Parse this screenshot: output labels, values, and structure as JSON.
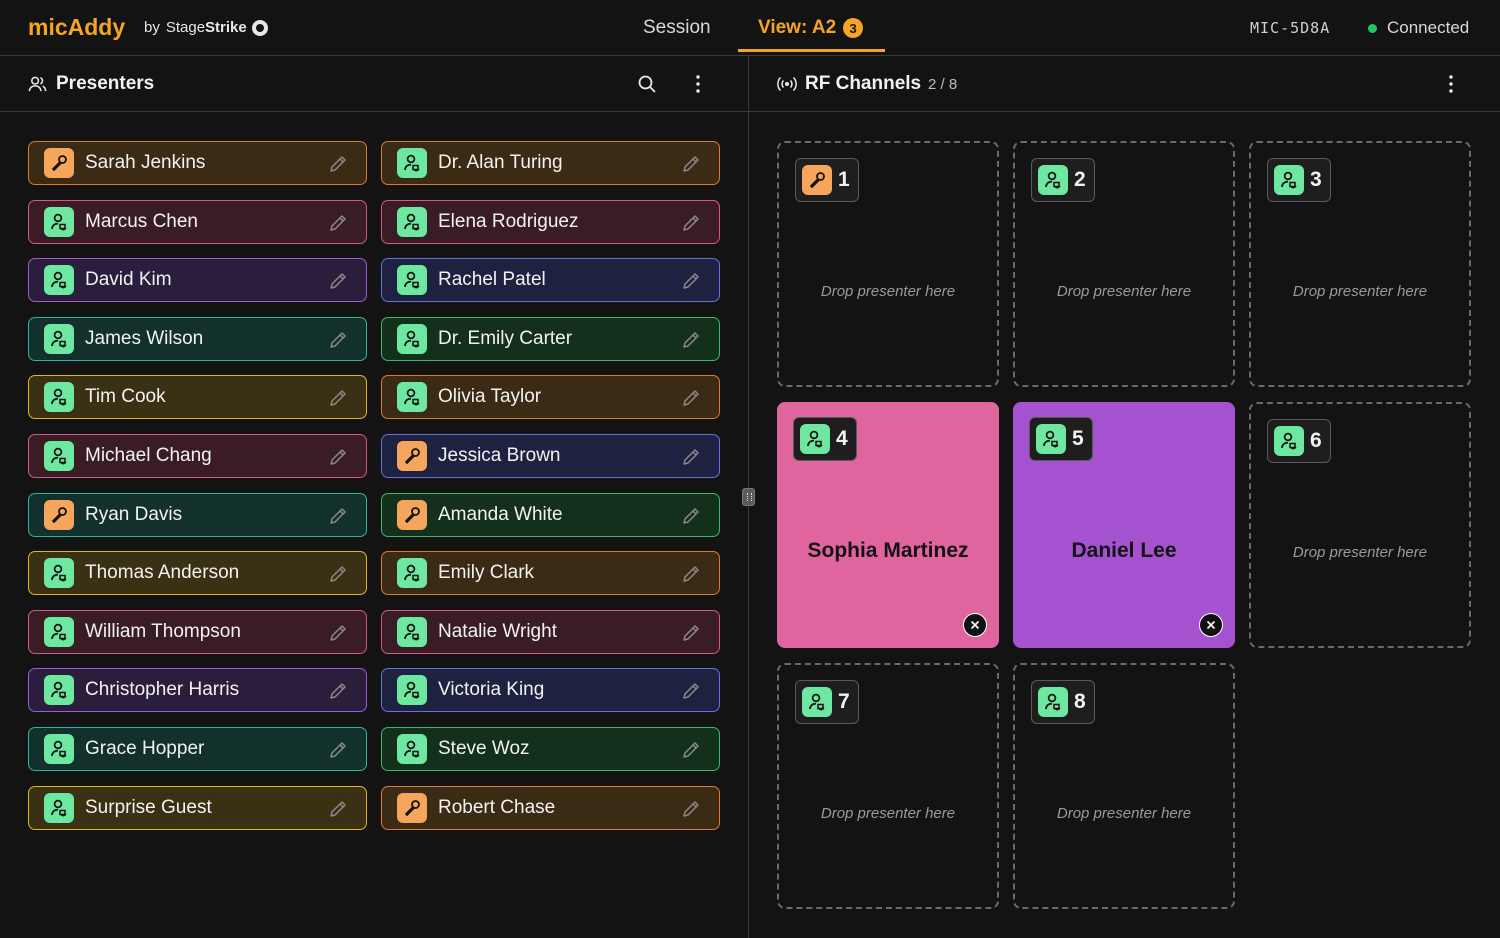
{
  "app": {
    "logo": "micAddy",
    "by": "by",
    "brand_a": "Stage",
    "brand_b": "Strike"
  },
  "nav": {
    "session_label": "Session",
    "view_label": "View: A2",
    "view_badge": "3"
  },
  "device": {
    "id": "MIC-5D8A",
    "status": "Connected",
    "status_color": "#22c55e"
  },
  "presenters_panel": {
    "title": "Presenters",
    "items": [
      {
        "name": "Sarah Jenkins",
        "color": "orange",
        "mic": "handheld"
      },
      {
        "name": "Dr. Alan Turing",
        "color": "orange",
        "mic": "lavalier"
      },
      {
        "name": "Marcus Chen",
        "color": "pink",
        "mic": "lavalier"
      },
      {
        "name": "Elena Rodriguez",
        "color": "pink",
        "mic": "lavalier"
      },
      {
        "name": "David Kim",
        "color": "purple",
        "mic": "lavalier"
      },
      {
        "name": "Rachel Patel",
        "color": "blue",
        "mic": "lavalier"
      },
      {
        "name": "James Wilson",
        "color": "teal",
        "mic": "lavalier"
      },
      {
        "name": "Dr. Emily Carter",
        "color": "green",
        "mic": "lavalier"
      },
      {
        "name": "Tim Cook",
        "color": "yellow",
        "mic": "lavalier"
      },
      {
        "name": "Olivia Taylor",
        "color": "orange",
        "mic": "lavalier"
      },
      {
        "name": "Michael Chang",
        "color": "pink",
        "mic": "lavalier"
      },
      {
        "name": "Jessica Brown",
        "color": "blue",
        "mic": "handheld"
      },
      {
        "name": "Ryan Davis",
        "color": "teal",
        "mic": "handheld"
      },
      {
        "name": "Amanda White",
        "color": "green",
        "mic": "handheld"
      },
      {
        "name": "Thomas Anderson",
        "color": "yellow",
        "mic": "lavalier"
      },
      {
        "name": "Emily Clark",
        "color": "orange",
        "mic": "lavalier"
      },
      {
        "name": "William Thompson",
        "color": "pink",
        "mic": "lavalier"
      },
      {
        "name": "Natalie Wright",
        "color": "pink",
        "mic": "lavalier"
      },
      {
        "name": "Christopher Harris",
        "color": "purple",
        "mic": "lavalier"
      },
      {
        "name": "Victoria King",
        "color": "blue",
        "mic": "lavalier"
      },
      {
        "name": "Grace Hopper",
        "color": "teal",
        "mic": "lavalier"
      },
      {
        "name": "Steve Woz",
        "color": "green",
        "mic": "lavalier"
      },
      {
        "name": "Surprise Guest",
        "color": "yellow",
        "mic": "lavalier"
      },
      {
        "name": "Robert Chase",
        "color": "orange",
        "mic": "handheld"
      }
    ]
  },
  "rf_panel": {
    "title": "RF Channels",
    "count": "2 / 8",
    "drop_text": "Drop presenter here",
    "channels": [
      {
        "number": "1",
        "mic": "handheld",
        "presenter": null,
        "bg": null
      },
      {
        "number": "2",
        "mic": "lavalier",
        "presenter": null,
        "bg": null
      },
      {
        "number": "3",
        "mic": "lavalier",
        "presenter": null,
        "bg": null
      },
      {
        "number": "4",
        "mic": "lavalier",
        "presenter": "Sophia Martinez",
        "bg": "#e0659f"
      },
      {
        "number": "5",
        "mic": "lavalier",
        "presenter": "Daniel Lee",
        "bg": "#a452d0"
      },
      {
        "number": "6",
        "mic": "lavalier",
        "presenter": null,
        "bg": null
      },
      {
        "number": "7",
        "mic": "lavalier",
        "presenter": null,
        "bg": null
      },
      {
        "number": "8",
        "mic": "lavalier",
        "presenter": null,
        "bg": null
      }
    ]
  },
  "colors": {
    "accent": "#f5a524",
    "background": "#141313"
  }
}
